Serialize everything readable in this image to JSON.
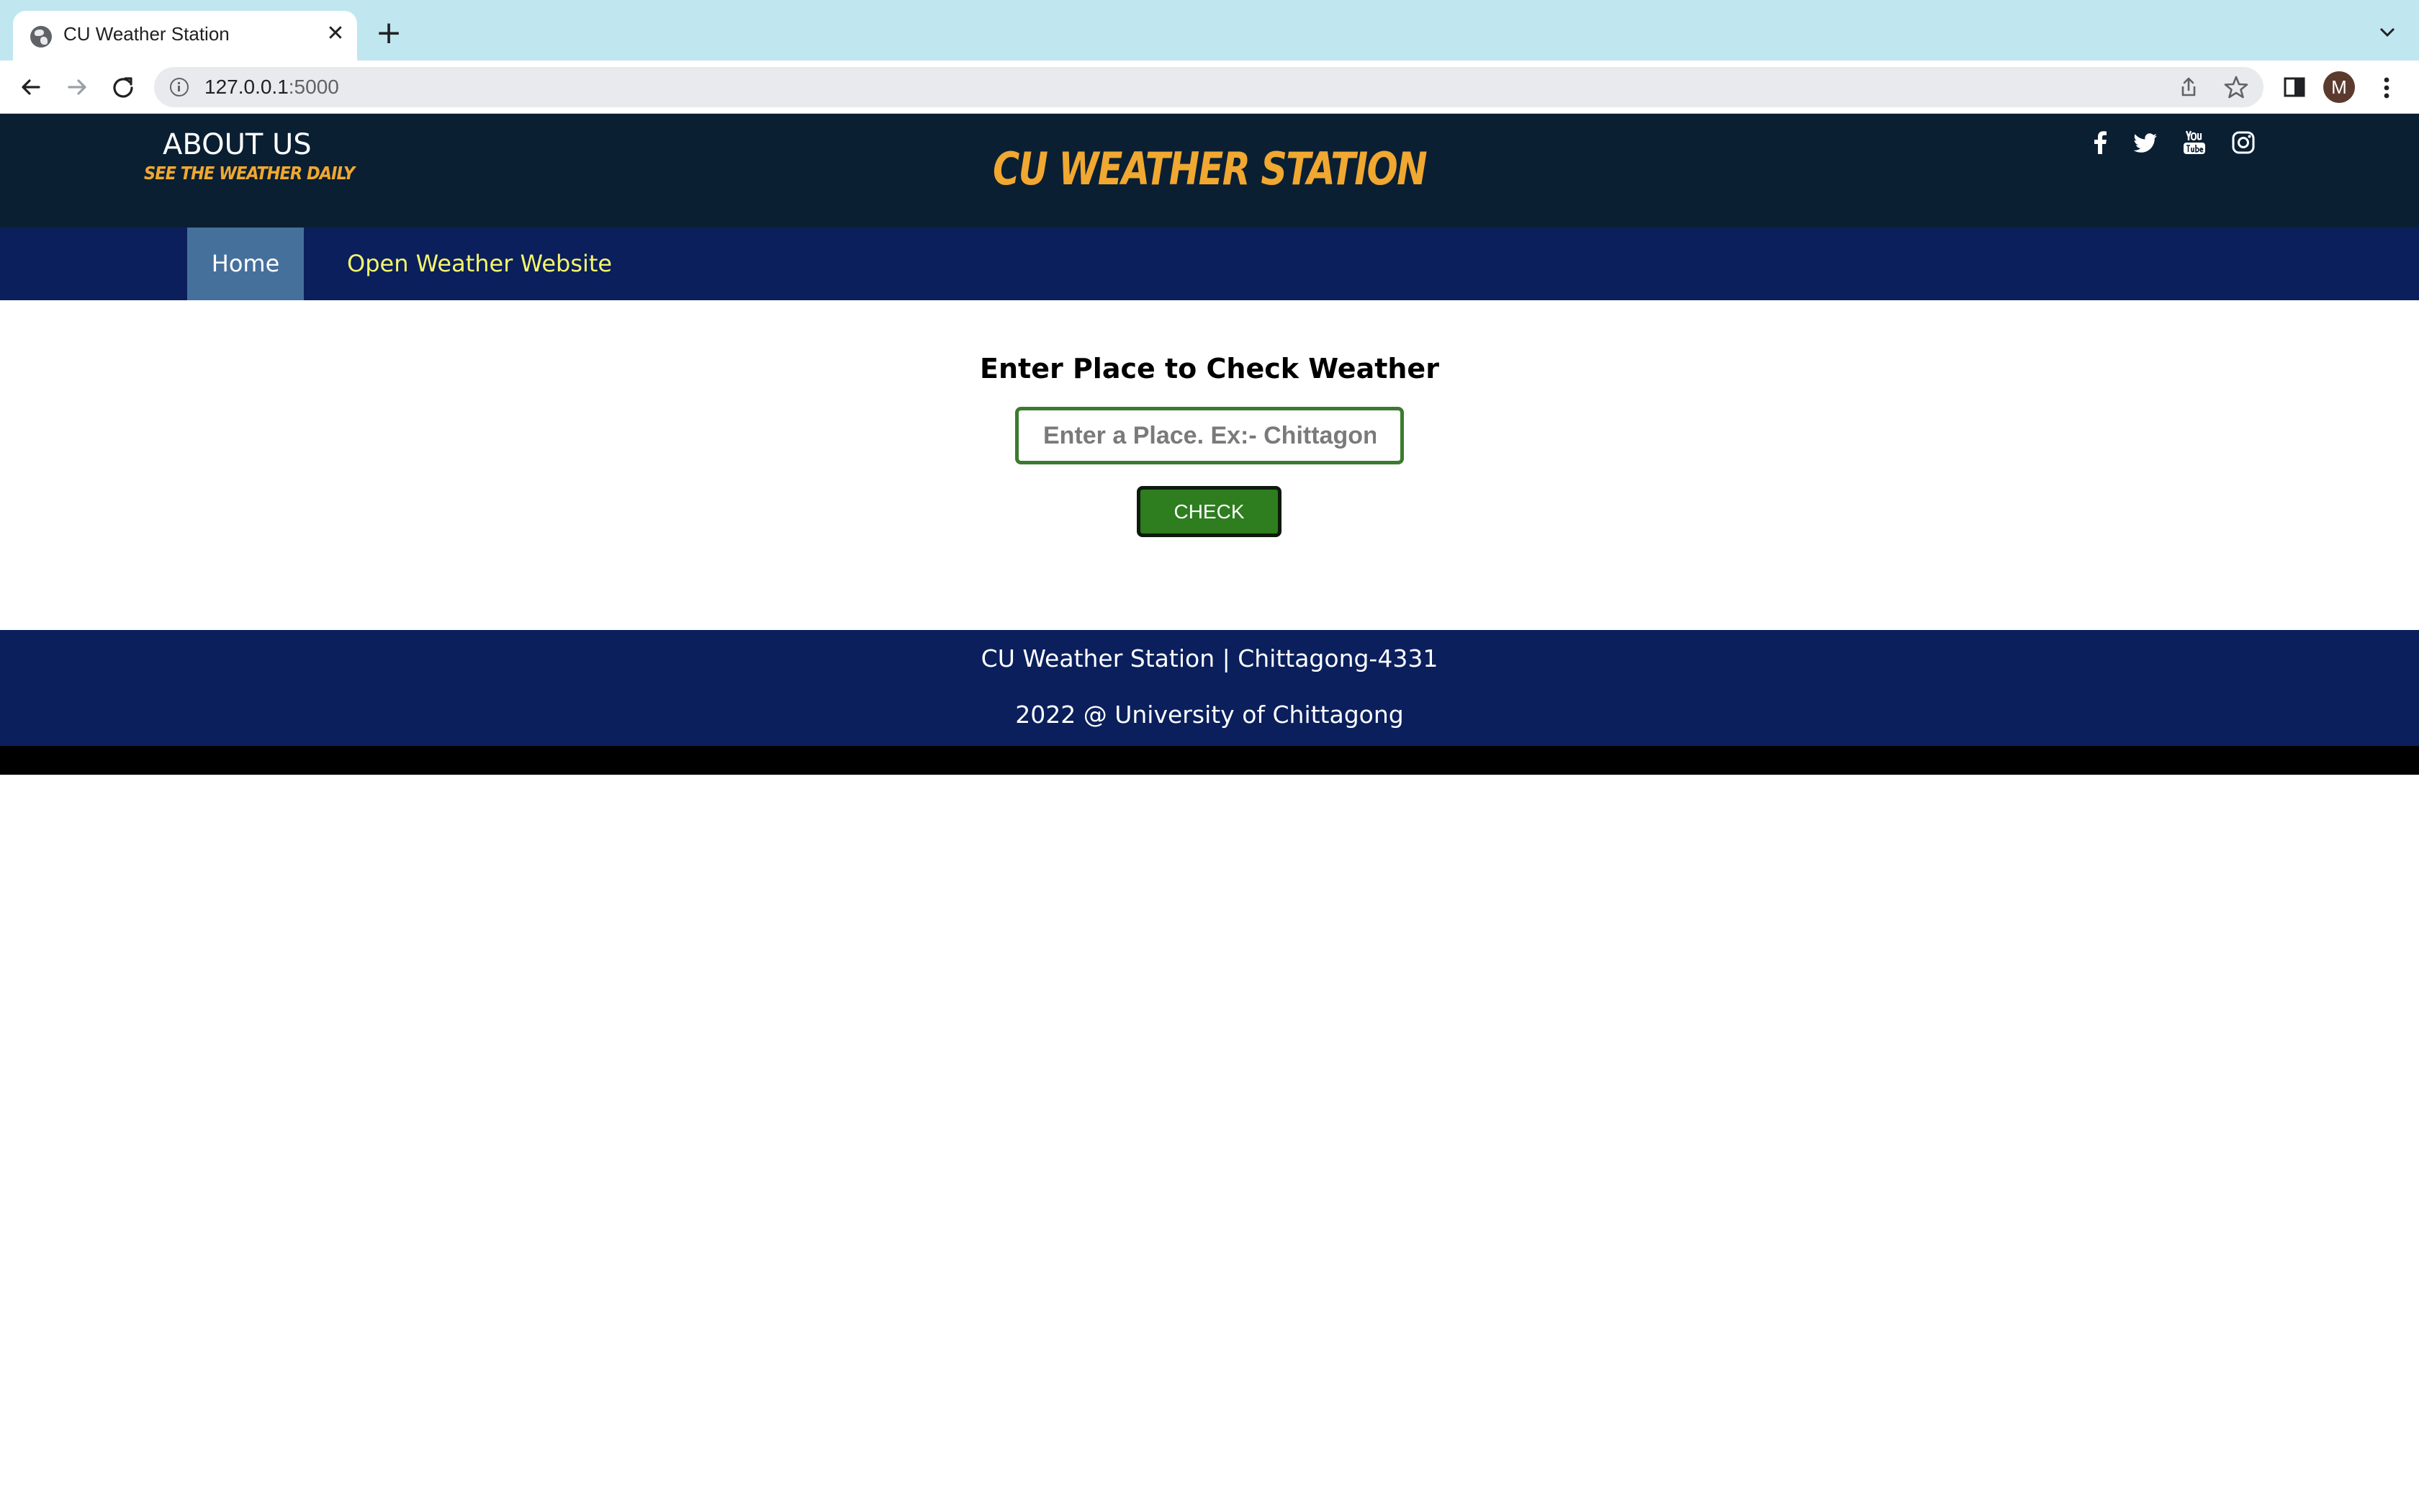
{
  "browser": {
    "tab_title": "CU Weather Station",
    "tab_close_glyph": "✕",
    "new_tab_glyph": "+",
    "url_host": "127.0.0.1",
    "url_port": ":5000",
    "profile_initial": "M",
    "icons": [
      "globe-icon",
      "close-icon",
      "plus-icon",
      "chevron-down-icon",
      "back-arrow-icon",
      "forward-arrow-icon",
      "reload-icon",
      "info-icon",
      "share-icon",
      "star-icon",
      "side-panel-icon",
      "kebab-menu-icon"
    ]
  },
  "header": {
    "about_label": "ABOUT US",
    "tagline": "SEE THE WEATHER DAILY",
    "site_title": "CU WEATHER STATION",
    "social_icons": [
      "facebook-icon",
      "twitter-icon",
      "youtube-icon",
      "instagram-icon"
    ],
    "accent_color": "#f0a830",
    "background_color": "#0b1f33"
  },
  "nav": {
    "home_label": "Home",
    "open_weather_label": "Open Weather Website",
    "bar_color": "#0a1f5c",
    "active_color": "#46709c",
    "link_color": "#f5f56a"
  },
  "main": {
    "heading": "Enter Place to Check Weather",
    "input_placeholder": "Enter a Place. Ex:- Chittagong",
    "input_value": "",
    "check_label": "CHECK",
    "button_color": "#2e7d1f"
  },
  "footer": {
    "line1": "CU Weather Station | Chittagong-4331",
    "line2": "2022 @ University of Chittagong"
  }
}
